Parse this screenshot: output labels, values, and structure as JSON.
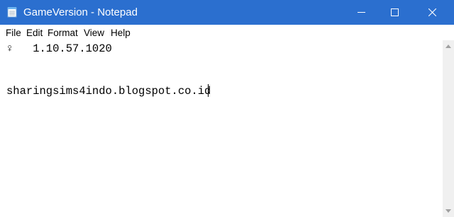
{
  "window": {
    "title": "GameVersion - Notepad",
    "titlebar_color": "#2b6fcf",
    "app_icon": "notepad-icon",
    "controls": [
      "minimize-icon",
      "maximize-icon",
      "close-icon"
    ]
  },
  "menubar": {
    "items": [
      "File",
      "Edit",
      "Format",
      "View",
      "Help"
    ]
  },
  "editor": {
    "lines": [
      "♀   1.10.57.1020",
      "sharingsims4indo.blogspot.co.id"
    ]
  }
}
